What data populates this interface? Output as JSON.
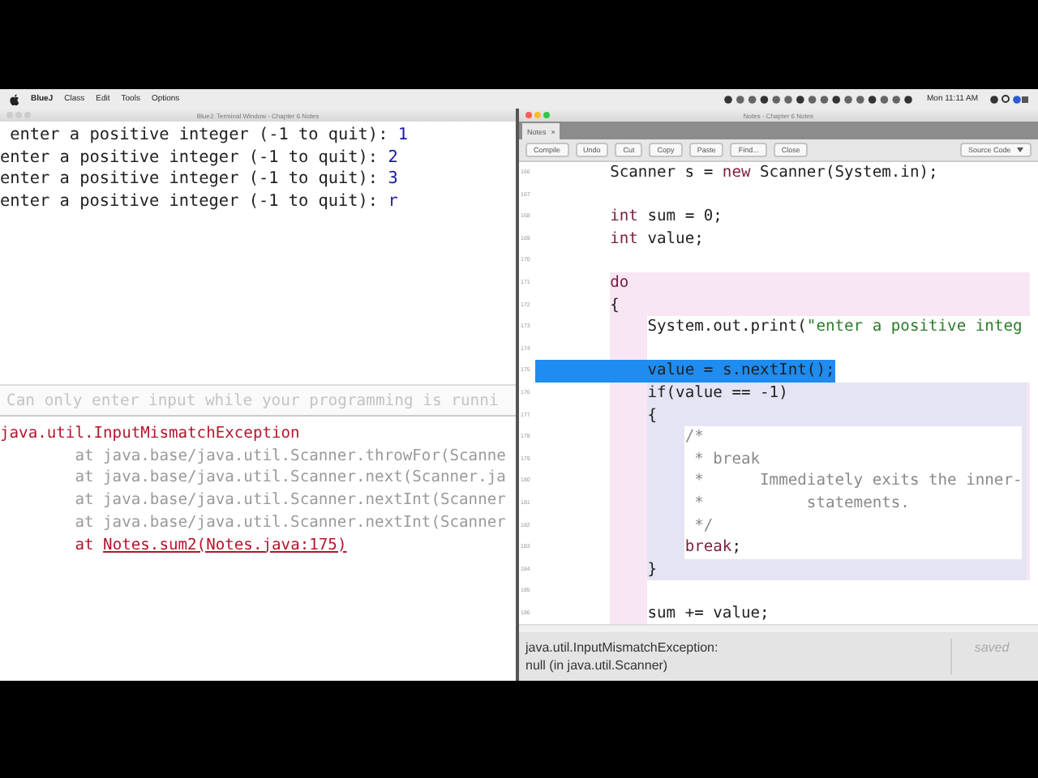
{
  "menu_bar": {
    "app": "BlueJ",
    "items": [
      "Class",
      "Edit",
      "Tools",
      "Options"
    ],
    "clock": "Mon 11:11 AM"
  },
  "terminal_window": {
    "title": "BlueJ: Terminal Window - Chapter 6 Notes",
    "lines": [
      {
        "prompt": " enter a positive integer (-1 to quit): ",
        "input": "1"
      },
      {
        "prompt": "enter a positive integer (-1 to quit): ",
        "input": "2"
      },
      {
        "prompt": "enter a positive integer (-1 to quit): ",
        "input": "3"
      },
      {
        "prompt": "enter a positive integer (-1 to quit): ",
        "input": "r"
      }
    ],
    "input_field": {
      "placeholder": "Can only enter input while your programming is runni"
    },
    "error_lines": [
      {
        "kind": "exception",
        "text": "java.util.InputMismatchException"
      },
      {
        "kind": "frame",
        "text": "        at java.base/java.util.Scanner.throwFor(Scanne"
      },
      {
        "kind": "frame",
        "text": "        at java.base/java.util.Scanner.next(Scanner.ja"
      },
      {
        "kind": "frame",
        "text": "        at java.base/java.util.Scanner.nextInt(Scanner"
      },
      {
        "kind": "frame",
        "text": "        at java.base/java.util.Scanner.nextInt(Scanner"
      },
      {
        "kind": "link",
        "text": "        at ",
        "link": "Notes.sum2(Notes.java:175)"
      }
    ]
  },
  "editor_window": {
    "title": "Notes - Chapter 6 Notes",
    "tabs": [
      {
        "label": "Notes",
        "close": "×",
        "selected": true
      }
    ],
    "toolbar": [
      "Compile",
      "Undo",
      "Cut",
      "Copy",
      "Paste",
      "Find...",
      "Close"
    ],
    "view_select": "Source Code",
    "code_lines": [
      {
        "number": "166",
        "kind": "plain",
        "highlighted": false,
        "tokens": [
          {
            "kind": "plain",
            "text": "    Scanner s = "
          },
          {
            "kind": "keyword",
            "text": "new"
          },
          {
            "kind": "plain",
            "text": " Scanner(System.in);"
          }
        ]
      },
      {
        "number": "167",
        "kind": "plain",
        "highlighted": false
      },
      {
        "number": "168",
        "kind": "plain",
        "highlighted": false,
        "tokens": [
          {
            "kind": "keyword",
            "text": "    int"
          },
          {
            "kind": "plain",
            "text": " sum = 0;"
          }
        ]
      },
      {
        "number": "169",
        "kind": "plain",
        "highlighted": false,
        "tokens": [
          {
            "kind": "keyword",
            "text": "    int"
          },
          {
            "kind": "plain",
            "text": " value;"
          }
        ]
      },
      {
        "number": "170",
        "kind": "plain",
        "highlighted": false
      },
      {
        "number": "171",
        "kind": "loop",
        "highlighted": false,
        "tokens": [
          {
            "kind": "keyword",
            "text": "do"
          }
        ]
      },
      {
        "number": "172",
        "kind": "loop",
        "highlighted": false,
        "tokens": [
          {
            "kind": "plain",
            "text": "{"
          }
        ]
      },
      {
        "number": "173",
        "kind": "body",
        "highlighted": false,
        "tokens": [
          {
            "kind": "plain",
            "text": "System.out.print("
          },
          {
            "kind": "string",
            "text": "\"enter a positive integ"
          }
        ]
      },
      {
        "number": "174",
        "kind": "body",
        "highlighted": false
      },
      {
        "number": "175",
        "kind": "body",
        "highlighted": true,
        "tokens": [
          {
            "kind": "plain",
            "text": "value = s.nextInt();"
          }
        ]
      },
      {
        "number": "176",
        "kind": "if",
        "highlighted": false,
        "tokens": [
          {
            "kind": "plain",
            "text": "if(value == -1)"
          }
        ]
      },
      {
        "number": "177",
        "kind": "if",
        "highlighted": false,
        "tokens": [
          {
            "kind": "plain",
            "text": "{"
          }
        ]
      },
      {
        "number": "178",
        "kind": "if-body",
        "highlighted": false,
        "tokens": [
          {
            "kind": "comment",
            "text": "/*"
          }
        ]
      },
      {
        "number": "179",
        "kind": "if-body",
        "highlighted": false,
        "tokens": [
          {
            "kind": "comment",
            "text": " * break"
          }
        ]
      },
      {
        "number": "180",
        "kind": "if-body",
        "highlighted": false,
        "tokens": [
          {
            "kind": "comment",
            "text": " *      Immediately exits the inner-"
          }
        ]
      },
      {
        "number": "181",
        "kind": "if-body",
        "highlighted": false,
        "tokens": [
          {
            "kind": "comment",
            "text": " *           statements."
          }
        ]
      },
      {
        "number": "182",
        "kind": "if-body",
        "highlighted": false,
        "tokens": [
          {
            "kind": "comment",
            "text": " */"
          }
        ]
      },
      {
        "number": "183",
        "kind": "if-body",
        "highlighted": false,
        "tokens": [
          {
            "kind": "keyword",
            "text": "break"
          },
          {
            "kind": "plain",
            "text": ";"
          }
        ]
      },
      {
        "number": "184",
        "kind": "if",
        "highlighted": false,
        "tokens": [
          {
            "kind": "plain",
            "text": "}"
          }
        ]
      },
      {
        "number": "185",
        "kind": "body",
        "highlighted": false
      },
      {
        "number": "186",
        "kind": "body",
        "highlighted": false,
        "tokens": [
          {
            "kind": "plain",
            "text": "sum += value;"
          }
        ]
      }
    ],
    "status": {
      "message": "java.util.InputMismatchException:",
      "detail": "null (in java.util.Scanner)",
      "saved": "saved"
    }
  }
}
